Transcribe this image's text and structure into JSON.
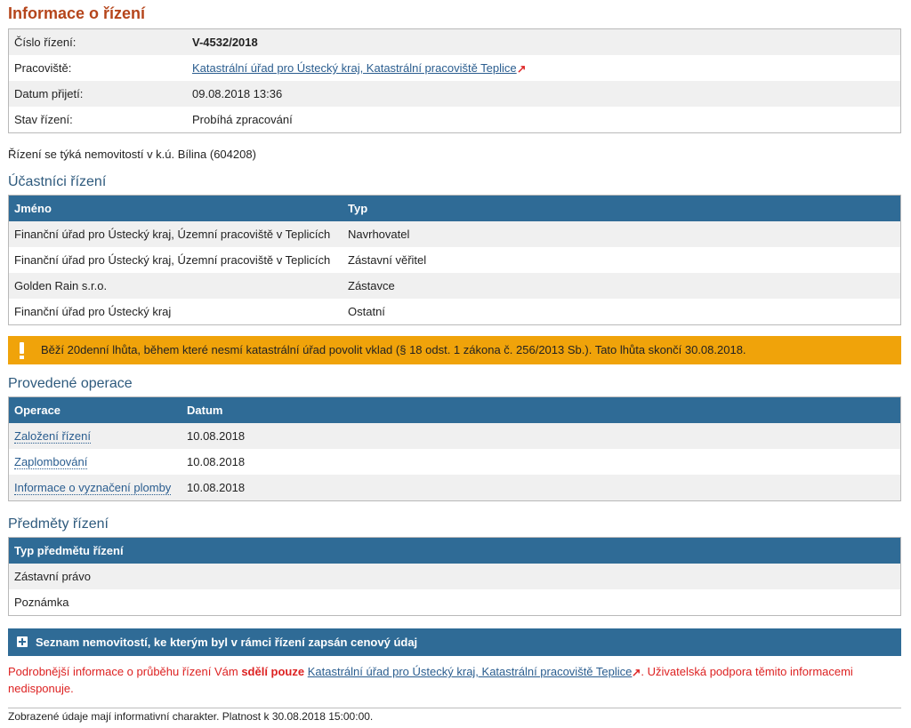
{
  "title": "Informace o řízení",
  "info": {
    "rows": [
      {
        "label": "Číslo řízení:",
        "value": "V-4532/2018"
      },
      {
        "label": "Pracoviště:",
        "value": "Katastrální úřad pro Ústecký kraj, Katastrální pracoviště Teplice"
      },
      {
        "label": "Datum přijetí:",
        "value": "09.08.2018 13:36"
      },
      {
        "label": "Stav řízení:",
        "value": "Probíhá zpracování"
      }
    ]
  },
  "property_note": "Řízení se týká nemovitostí v k.ú. Bílina (604208)",
  "participants": {
    "heading": "Účastníci řízení",
    "columns": [
      "Jméno",
      "Typ"
    ],
    "rows": [
      [
        "Finanční úřad pro Ústecký kraj, Územní pracoviště v Teplicích",
        "Navrhovatel"
      ],
      [
        "Finanční úřad pro Ústecký kraj, Územní pracoviště v Teplicích",
        "Zástavní věřitel"
      ],
      [
        "Golden Rain s.r.o.",
        "Zástavce"
      ],
      [
        "Finanční úřad pro Ústecký kraj",
        "Ostatní"
      ]
    ]
  },
  "warning": "Běží 20denní lhůta, během které nesmí katastrální úřad povolit vklad (§ 18 odst. 1 zákona č. 256/2013 Sb.). Tato lhůta skončí 30.08.2018.",
  "operations": {
    "heading": "Provedené operace",
    "columns": [
      "Operace",
      "Datum"
    ],
    "rows": [
      [
        "Založení řízení",
        "10.08.2018"
      ],
      [
        "Zaplombování",
        "10.08.2018"
      ],
      [
        "Informace o vyznačení plomby",
        "10.08.2018"
      ]
    ]
  },
  "subjects": {
    "heading": "Předměty řízení",
    "columns": [
      "Typ předmětu řízení"
    ],
    "rows": [
      "Zástavní právo",
      "Poznámka"
    ]
  },
  "expander_label": "Seznam nemovitostí, ke kterým byl v rámci řízení zapsán cenový údaj",
  "notice": {
    "before": "Podrobnější informace o průběhu řízení Vám ",
    "bold": "sdělí pouze",
    "link": "Katastrální úřad pro Ústecký kraj, Katastrální pracoviště Teplice",
    "after": ". Uživatelská podpora těmito informacemi nedisponuje."
  },
  "footer": "Zobrazené údaje mají informativní charakter. Platnost k 30.08.2018 15:00:00.",
  "colors": {
    "header_blue": "#2f6b96",
    "title_orange": "#b5451b",
    "warning_amber": "#f0a30a",
    "notice_red": "#dd2222"
  },
  "icons": [
    "external-link-icon",
    "warning-icon",
    "plus-icon"
  ]
}
